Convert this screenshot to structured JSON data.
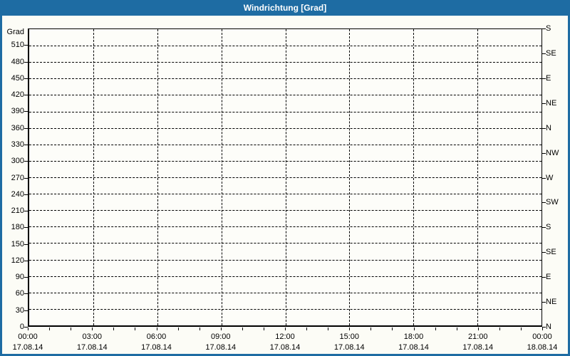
{
  "window": {
    "title": "Windrichtung [Grad]",
    "colors": {
      "title_bar": "#1e6ca3",
      "border": "#1e6ca3",
      "background": "#fcfcf6",
      "plot_background": "#fdfdf9",
      "grid": "#000000",
      "text": "#000000",
      "title_text": "#ffffff"
    }
  },
  "chart_data": {
    "type": "line",
    "title": "Windrichtung [Grad]",
    "series": [],
    "grid": "dashed",
    "y_axis_left": {
      "unit_label": "Grad",
      "min": 0,
      "max": 540,
      "tick_step": 30,
      "tick_values": [
        0,
        30,
        60,
        90,
        120,
        150,
        180,
        210,
        240,
        270,
        300,
        330,
        360,
        390,
        420,
        450,
        480,
        510
      ],
      "gridline_values": [
        30,
        60,
        90,
        120,
        150,
        180,
        210,
        240,
        270,
        300,
        330,
        360,
        390,
        420,
        450,
        480,
        510
      ]
    },
    "y_axis_right": {
      "tick_step_degrees": 45,
      "labels_bottom_to_top": [
        "N",
        "NE",
        "E",
        "SE",
        "S",
        "SW",
        "W",
        "NW",
        "N",
        "NE",
        "E",
        "SE",
        "S"
      ]
    },
    "x_axis": {
      "range_hours": 24,
      "minor_tick_every_hours": 1,
      "major_tick_hours": [
        0,
        3,
        6,
        9,
        12,
        15,
        18,
        21,
        24
      ],
      "major_tick_times": [
        "00:00",
        "03:00",
        "06:00",
        "09:00",
        "12:00",
        "15:00",
        "18:00",
        "21:00",
        "00:00"
      ],
      "major_tick_dates": [
        "17.08.14",
        "17.08.14",
        "17.08.14",
        "17.08.14",
        "17.08.14",
        "17.08.14",
        "17.08.14",
        "17.08.14",
        "18.08.14"
      ],
      "gridline_hours": [
        3,
        6,
        9,
        12,
        15,
        18,
        21
      ]
    }
  }
}
